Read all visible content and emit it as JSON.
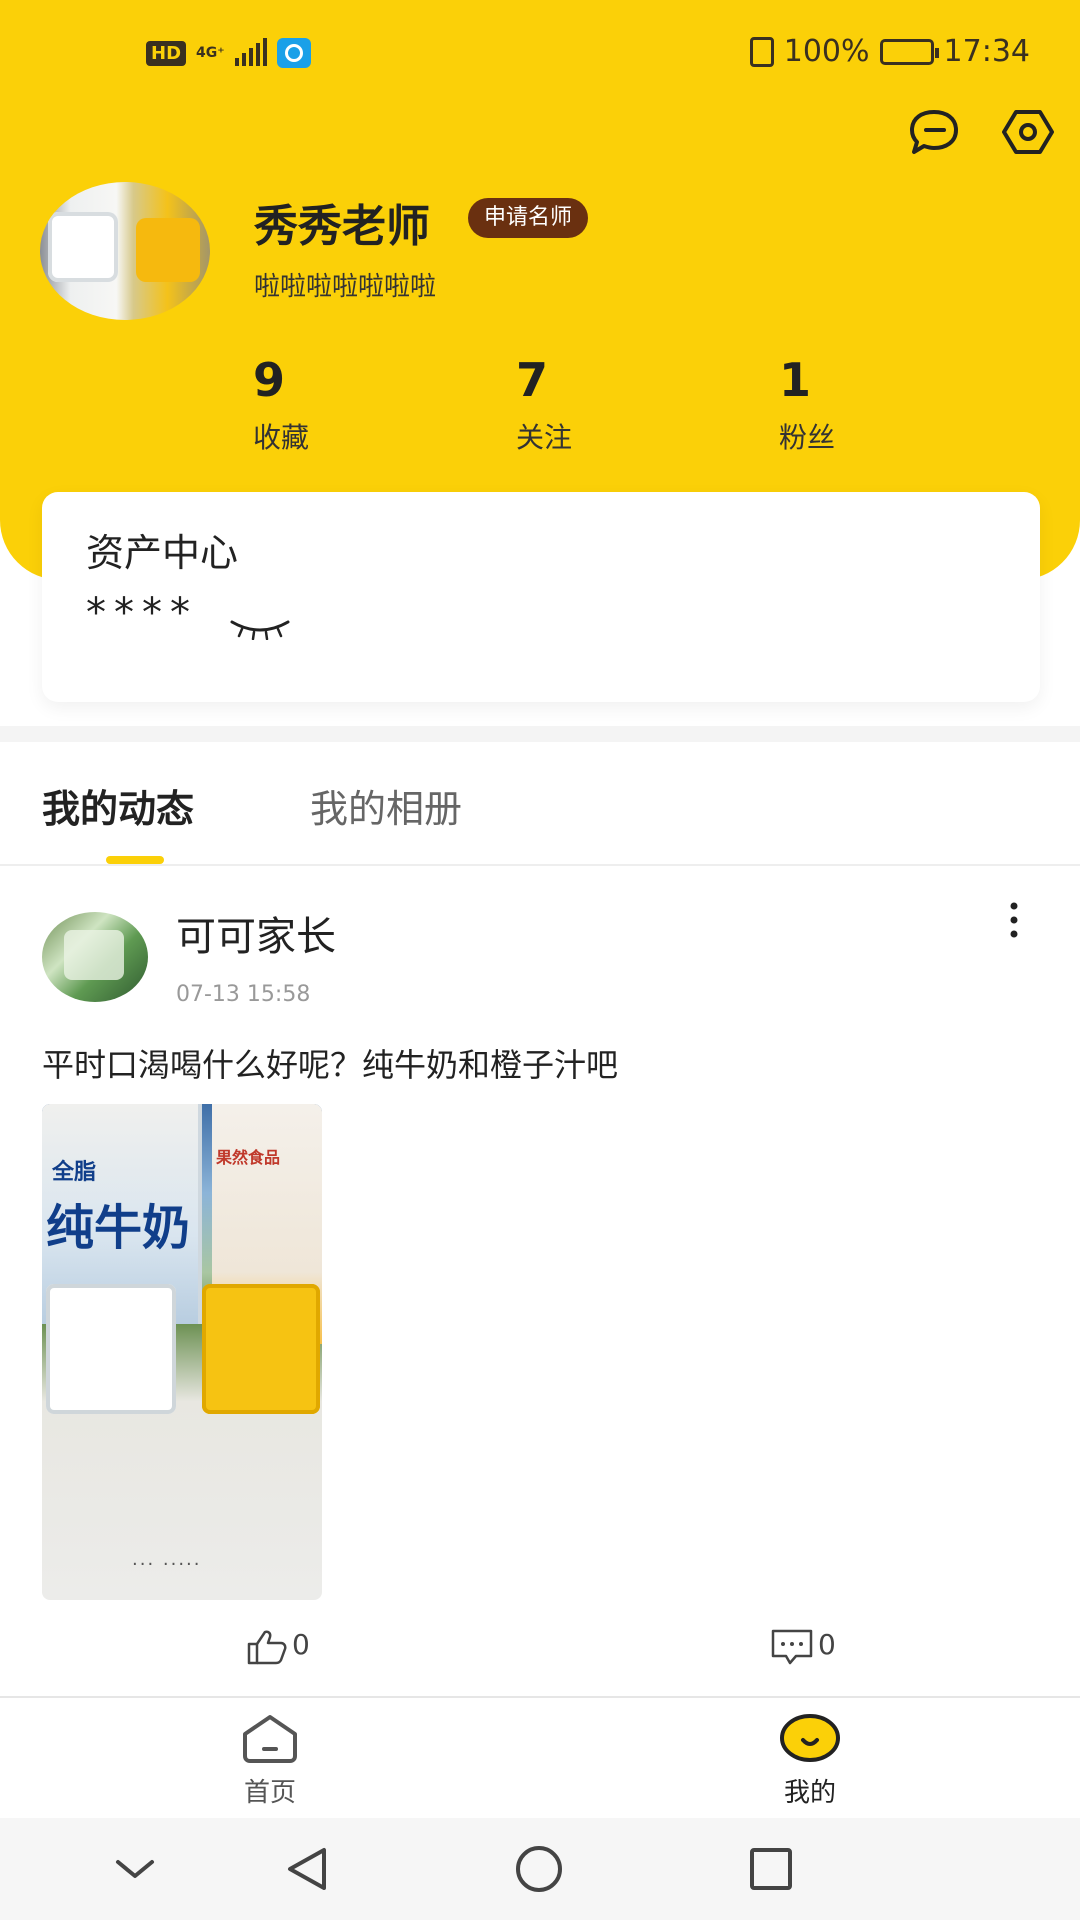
{
  "status_bar": {
    "hd": "HD",
    "network": "4G⁺",
    "battery_pct": "100%",
    "time": "17:34"
  },
  "profile": {
    "name": "秀秀老师",
    "apply_tag": "申请名师",
    "bio": "啦啦啦啦啦啦啦",
    "stats": [
      {
        "value": "9",
        "label": "收藏"
      },
      {
        "value": "7",
        "label": "关注"
      },
      {
        "value": "1",
        "label": "粉丝"
      }
    ]
  },
  "assets": {
    "title": "资产中心",
    "masked_value": "****"
  },
  "tabs": [
    {
      "label": "我的动态",
      "active": true
    },
    {
      "label": "我的相册",
      "active": false
    }
  ],
  "post": {
    "author": "可可家长",
    "time": "07-13 15:58",
    "text": "平时口渴喝什么好呢？纯牛奶和橙子汁吧",
    "image_labels": {
      "carton_small": "全脂",
      "carton_big": "纯牛奶",
      "bottle": "果然食品"
    },
    "likes": "0",
    "comments": "0"
  },
  "bottom_nav": [
    {
      "label": "首页",
      "icon": "home-icon"
    },
    {
      "label": "我的",
      "icon": "smile-icon"
    }
  ],
  "colors": {
    "accent": "#FBD008",
    "tag_bg": "#6A3010"
  }
}
